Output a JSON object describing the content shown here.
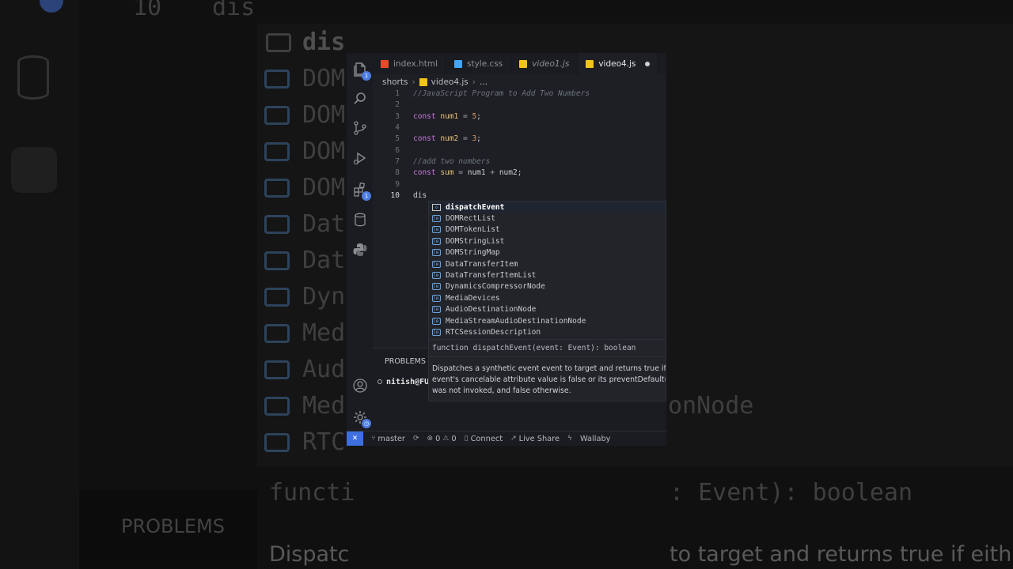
{
  "tabs": [
    {
      "label": "index.html",
      "icon": "html-file-icon",
      "color": "#e44d26",
      "italic": false,
      "active": false
    },
    {
      "label": "style.css",
      "icon": "css-file-icon",
      "color": "#42a5f5",
      "italic": false,
      "active": false
    },
    {
      "label": "video1.js",
      "icon": "js-file-icon",
      "color": "#f0c419",
      "italic": true,
      "active": false
    },
    {
      "label": "video4.js",
      "icon": "js-file-icon",
      "color": "#f0c419",
      "italic": false,
      "active": true
    }
  ],
  "breadcrumb": {
    "folder": "shorts",
    "file": "video4.js",
    "more": "..."
  },
  "activity": {
    "explorer_badge": "1",
    "extensions_badge": "1"
  },
  "editor": {
    "line_numbers": [
      "1",
      "2",
      "3",
      "4",
      "5",
      "6",
      "7",
      "8",
      "9",
      "10"
    ],
    "lines": {
      "l1_comment": "//JavaScript Program to Add Two Numbers",
      "l3_kw": "const",
      "l3_var": "num1",
      "l3_eq": "=",
      "l3_val": "5",
      "l3_end": ";",
      "l5_kw": "const",
      "l5_var": "num2",
      "l5_eq": "=",
      "l5_val": "3",
      "l5_end": ";",
      "l7_comment": "//add two numbers",
      "l8_kw": "const",
      "l8_var": "sum",
      "l8_eq": "=",
      "l8_a": "num1",
      "l8_plus": "+",
      "l8_b": "num2",
      "l8_end": ";",
      "l10_text": "dis"
    }
  },
  "suggestions": [
    {
      "label": "dispatchEvent",
      "icon": "method-cube-icon",
      "selected": true
    },
    {
      "label": "DOMRectList",
      "icon": "variable-icon"
    },
    {
      "label": "DOMTokenList",
      "icon": "variable-icon"
    },
    {
      "label": "DOMStringList",
      "icon": "variable-icon"
    },
    {
      "label": "DOMStringMap",
      "icon": "variable-icon"
    },
    {
      "label": "DataTransferItem",
      "icon": "variable-icon"
    },
    {
      "label": "DataTransferItemList",
      "icon": "variable-icon"
    },
    {
      "label": "DynamicsCompressorNode",
      "icon": "variable-icon"
    },
    {
      "label": "MediaDevices",
      "icon": "variable-icon"
    },
    {
      "label": "AudioDestinationNode",
      "icon": "variable-icon"
    },
    {
      "label": "MediaStreamAudioDestinationNode",
      "icon": "variable-icon"
    },
    {
      "label": "RTCSessionDescription",
      "icon": "variable-icon"
    }
  ],
  "hover": {
    "signature": "function dispatchEvent(event: Event): boolean",
    "doc_line1": "Dispatches a synthetic event event to target and returns true if eith",
    "doc_line2": "event's cancelable attribute value is false or its preventDefault() m",
    "doc_line3": "was not invoked, and false otherwise."
  },
  "panel": {
    "title": "PROBLEMS",
    "terminal_line": "nitish@FUL"
  },
  "status": {
    "branch": "master",
    "errors": "0",
    "warnings": "0",
    "connect": "Connect",
    "live_share": "Live Share",
    "wallaby": "Wallaby"
  },
  "background": {
    "line_no": "10",
    "typed": "dis",
    "s1": "dis",
    "s2": "DOM",
    "s3": "DOM",
    "s4": "DOM",
    "s5": "DOM",
    "s6": "Dat",
    "s7": "Dat",
    "s8": "Dyn",
    "s9": "Med",
    "s10": "Aud",
    "s11": "Med",
    "s12": "RTC",
    "right_node": "onNode",
    "sig_left": "functi",
    "sig_right": ": Event): boolean",
    "panel_title": "PROBLEMS",
    "doc_left": "Dispatc",
    "doc_right": "to target and returns true if eith"
  }
}
